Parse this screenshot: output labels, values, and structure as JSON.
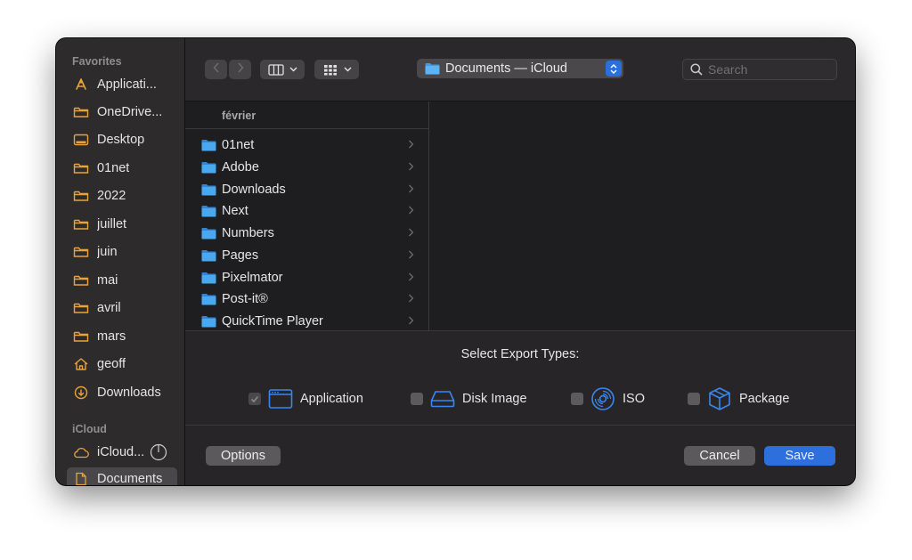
{
  "sidebar": {
    "favorites_title": "Favorites",
    "icloud_title": "iCloud",
    "favorites": [
      {
        "label": "Applicati...",
        "icon": "applications-icon"
      },
      {
        "label": "OneDrive...",
        "icon": "folder-icon"
      },
      {
        "label": "Desktop",
        "icon": "desktop-icon"
      },
      {
        "label": "01net",
        "icon": "folder-icon"
      },
      {
        "label": "2022",
        "icon": "folder-icon"
      },
      {
        "label": "juillet",
        "icon": "folder-icon"
      },
      {
        "label": "juin",
        "icon": "folder-icon"
      },
      {
        "label": "mai",
        "icon": "folder-icon"
      },
      {
        "label": "avril",
        "icon": "folder-icon"
      },
      {
        "label": "mars",
        "icon": "folder-icon"
      },
      {
        "label": "geoff",
        "icon": "home-icon"
      },
      {
        "label": "Downloads",
        "icon": "downloads-icon"
      }
    ],
    "icloud": [
      {
        "label": "iCloud...",
        "icon": "cloud-icon"
      },
      {
        "label": "Documents",
        "icon": "document-icon",
        "selected": true
      }
    ]
  },
  "toolbar": {
    "path_label": "Documents — iCloud",
    "search_placeholder": "Search"
  },
  "browser": {
    "column_header": "février",
    "items": [
      "01net",
      "Adobe",
      "Downloads",
      "Next",
      "Numbers",
      "Pages",
      "Pixelmator",
      "Post-it®",
      "QuickTime Player"
    ]
  },
  "export": {
    "title": "Select Export Types:",
    "options": [
      {
        "label": "Application",
        "checked": true,
        "disabled": true,
        "icon": "application-window-icon"
      },
      {
        "label": "Disk Image",
        "checked": false,
        "icon": "disk-image-icon"
      },
      {
        "label": "ISO",
        "checked": false,
        "icon": "iso-disc-icon"
      },
      {
        "label": "Package",
        "checked": false,
        "icon": "package-icon"
      }
    ]
  },
  "footer": {
    "options_label": "Options",
    "cancel_label": "Cancel",
    "save_label": "Save"
  },
  "colors": {
    "accent": "#2d6fdc",
    "sidebar_icon": "#e8a33a",
    "folder": "#3c9be6",
    "export_icon": "#3a86f0"
  }
}
